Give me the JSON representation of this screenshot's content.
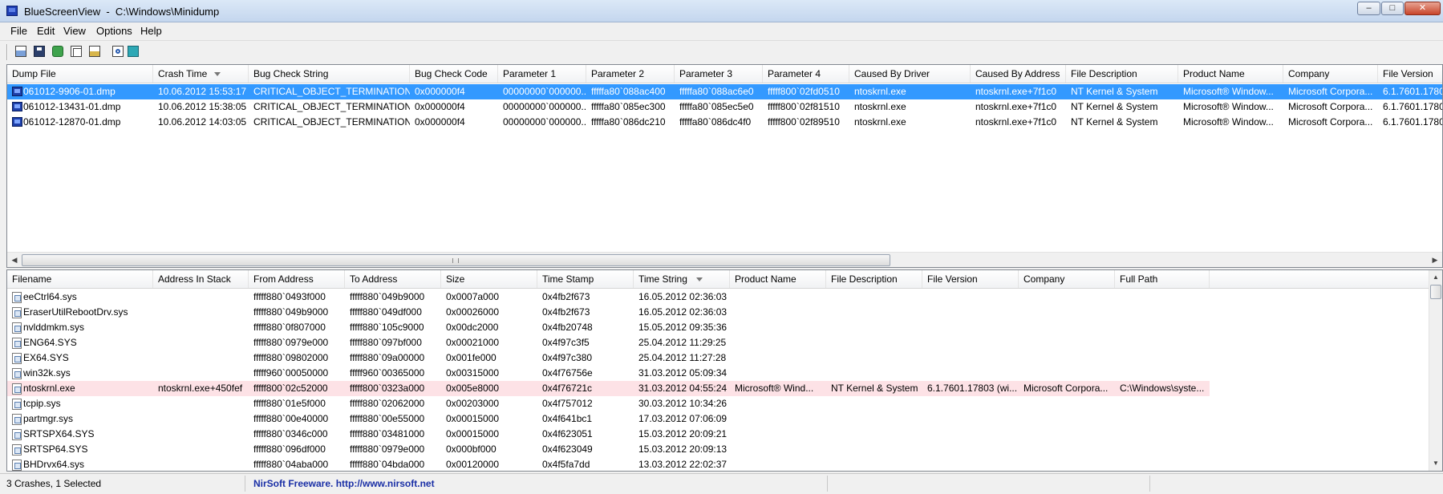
{
  "window": {
    "title": "BlueScreenView  -  C:\\Windows\\Minidump",
    "minimize": "–",
    "maximize": "□",
    "close": "✕"
  },
  "menu": [
    "File",
    "Edit",
    "View",
    "Options",
    "Help"
  ],
  "toolbar": {
    "buttons": [
      "properties-icon",
      "save-icon",
      "refresh-icon",
      "copy-icon",
      "advanced-options-icon",
      "find-icon",
      "exit-icon"
    ]
  },
  "upper": {
    "columns": [
      "Dump File",
      "Crash Time",
      "Bug Check String",
      "Bug Check Code",
      "Parameter 1",
      "Parameter 2",
      "Parameter 3",
      "Parameter 4",
      "Caused By Driver",
      "Caused By Address",
      "File Description",
      "Product Name",
      "Company",
      "File Version"
    ],
    "rows": [
      [
        "061012-9906-01.dmp",
        "10.06.2012 15:53:17",
        "CRITICAL_OBJECT_TERMINATION",
        "0x000000f4",
        "00000000`000000...",
        "fffffa80`088ac400",
        "fffffa80`088ac6e0",
        "fffff800`02fd0510",
        "ntoskrnl.exe",
        "ntoskrnl.exe+7f1c0",
        "NT Kernel & System",
        "Microsoft® Window...",
        "Microsoft Corpora...",
        "6.1.7601.1780"
      ],
      [
        "061012-13431-01.dmp",
        "10.06.2012 15:38:05",
        "CRITICAL_OBJECT_TERMINATION",
        "0x000000f4",
        "00000000`000000...",
        "fffffa80`085ec300",
        "fffffa80`085ec5e0",
        "fffff800`02f81510",
        "ntoskrnl.exe",
        "ntoskrnl.exe+7f1c0",
        "NT Kernel & System",
        "Microsoft® Window...",
        "Microsoft Corpora...",
        "6.1.7601.1780"
      ],
      [
        "061012-12870-01.dmp",
        "10.06.2012 14:03:05",
        "CRITICAL_OBJECT_TERMINATION",
        "0x000000f4",
        "00000000`000000...",
        "fffffa80`086dc210",
        "fffffa80`086dc4f0",
        "fffff800`02f89510",
        "ntoskrnl.exe",
        "ntoskrnl.exe+7f1c0",
        "NT Kernel & System",
        "Microsoft® Window...",
        "Microsoft Corpora...",
        "6.1.7601.1780"
      ]
    ],
    "selected_index": 0
  },
  "lower": {
    "columns": [
      "Filename",
      "Address In Stack",
      "From Address",
      "To Address",
      "Size",
      "Time Stamp",
      "Time String",
      "Product Name",
      "File Description",
      "File Version",
      "Company",
      "Full Path"
    ],
    "rows": [
      [
        "eeCtrl64.sys",
        "",
        "fffff880`0493f000",
        "fffff880`049b9000",
        "0x0007a000",
        "0x4fb2f673",
        "16.05.2012 02:36:03",
        "",
        "",
        "",
        "",
        ""
      ],
      [
        "EraserUtilRebootDrv.sys",
        "",
        "fffff880`049b9000",
        "fffff880`049df000",
        "0x00026000",
        "0x4fb2f673",
        "16.05.2012 02:36:03",
        "",
        "",
        "",
        "",
        ""
      ],
      [
        "nvlddmkm.sys",
        "",
        "fffff880`0f807000",
        "fffff880`105c9000",
        "0x00dc2000",
        "0x4fb20748",
        "15.05.2012 09:35:36",
        "",
        "",
        "",
        "",
        ""
      ],
      [
        "ENG64.SYS",
        "",
        "fffff880`0979e000",
        "fffff880`097bf000",
        "0x00021000",
        "0x4f97c3f5",
        "25.04.2012 11:29:25",
        "",
        "",
        "",
        "",
        ""
      ],
      [
        "EX64.SYS",
        "",
        "fffff880`09802000",
        "fffff880`09a00000",
        "0x001fe000",
        "0x4f97c380",
        "25.04.2012 11:27:28",
        "",
        "",
        "",
        "",
        ""
      ],
      [
        "win32k.sys",
        "",
        "fffff960`00050000",
        "fffff960`00365000",
        "0x00315000",
        "0x4f76756e",
        "31.03.2012 05:09:34",
        "",
        "",
        "",
        "",
        ""
      ],
      [
        "ntoskrnl.exe",
        "ntoskrnl.exe+450fef",
        "fffff800`02c52000",
        "fffff800`0323a000",
        "0x005e8000",
        "0x4f76721c",
        "31.03.2012 04:55:24",
        "Microsoft® Wind...",
        "NT Kernel & System",
        "6.1.7601.17803 (wi...",
        "Microsoft Corpora...",
        "C:\\Windows\\syste..."
      ],
      [
        "tcpip.sys",
        "",
        "fffff880`01e5f000",
        "fffff880`02062000",
        "0x00203000",
        "0x4f757012",
        "30.03.2012 10:34:26",
        "",
        "",
        "",
        "",
        ""
      ],
      [
        "partmgr.sys",
        "",
        "fffff880`00e40000",
        "fffff880`00e55000",
        "0x00015000",
        "0x4f641bc1",
        "17.03.2012 07:06:09",
        "",
        "",
        "",
        "",
        ""
      ],
      [
        "SRTSPX64.SYS",
        "",
        "fffff880`0346c000",
        "fffff880`03481000",
        "0x00015000",
        "0x4f623051",
        "15.03.2012 20:09:21",
        "",
        "",
        "",
        "",
        ""
      ],
      [
        "SRTSP64.SYS",
        "",
        "fffff880`096df000",
        "fffff880`0979e000",
        "0x000bf000",
        "0x4f623049",
        "15.03.2012 20:09:13",
        "",
        "",
        "",
        "",
        ""
      ],
      [
        "BHDrvx64.sys",
        "",
        "fffff880`04aba000",
        "fffff880`04bda000",
        "0x00120000",
        "0x4f5fa7dd",
        "13.03.2012 22:02:37",
        "",
        "",
        "",
        "",
        ""
      ]
    ],
    "highlight_index": 6
  },
  "status": {
    "count": "3 Crashes, 1 Selected",
    "link": "NirSoft Freeware.  http://www.nirsoft.net"
  },
  "colors": {
    "selection": "#3399ff",
    "highlight": "#fde2e6",
    "link": "#1a2fa6"
  }
}
